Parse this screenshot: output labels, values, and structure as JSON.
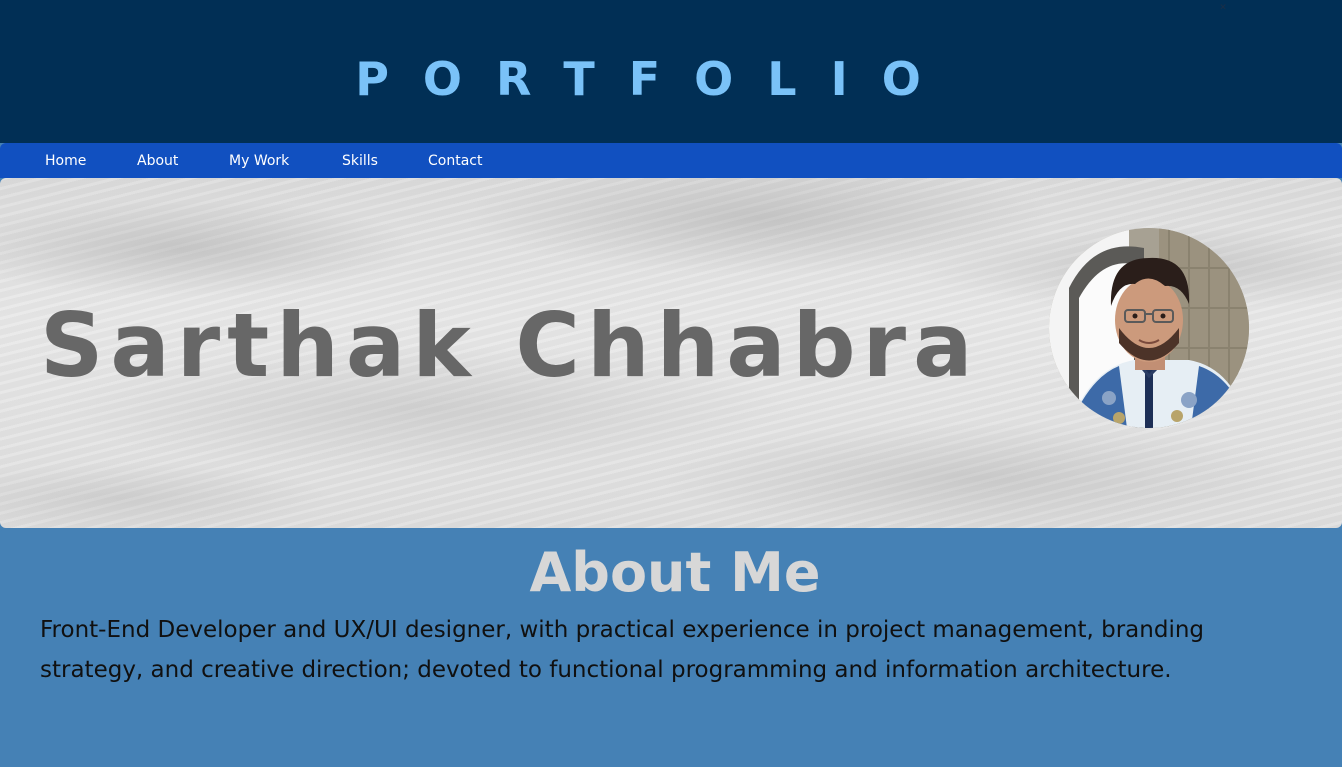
{
  "header": {
    "title": "PORTFOLIO"
  },
  "nav": {
    "items": [
      {
        "label": "Home"
      },
      {
        "label": "About"
      },
      {
        "label": "My Work"
      },
      {
        "label": "Skills"
      },
      {
        "label": "Contact"
      }
    ]
  },
  "hero": {
    "name": "Sarthak Chhabra"
  },
  "about": {
    "heading": "About Me",
    "body": "Front-End Developer and UX/UI designer, with practical experience in project management, branding strategy, and creative direction; devoted to functional programming and information architecture."
  },
  "colors": {
    "header_background": "#012f55",
    "title_color": "#7ac2f8",
    "nav_background": "#1150c0",
    "about_background": "#4581b5",
    "name_color": "#676767"
  }
}
